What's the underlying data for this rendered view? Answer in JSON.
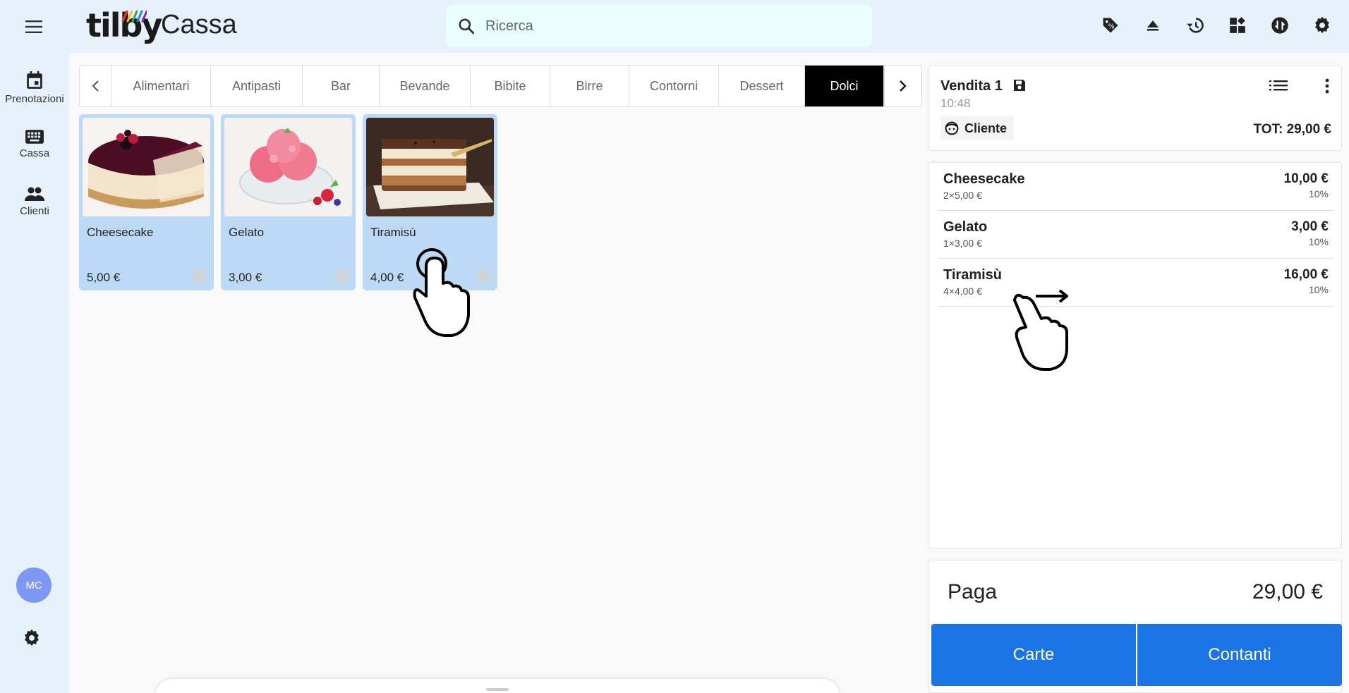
{
  "header": {
    "brand": "tilby",
    "title": "Cassa",
    "search_placeholder": "Ricerca",
    "icons": [
      "tag-icon",
      "eject-icon",
      "history-icon",
      "widgets-icon",
      "sync-icon",
      "settings-icon"
    ]
  },
  "sidebar": {
    "items": [
      {
        "label": "Prenotazioni",
        "icon": "calendar-icon"
      },
      {
        "label": "Cassa",
        "icon": "keyboard-icon"
      },
      {
        "label": "Clienti",
        "icon": "people-icon"
      }
    ],
    "avatar": "MC"
  },
  "categories": {
    "tabs": [
      "Alimentari",
      "Antipasti",
      "Bar",
      "Bevande",
      "Bibite",
      "Birre",
      "Contorni",
      "Dessert",
      "Dolci"
    ],
    "active": "Dolci"
  },
  "products": [
    {
      "name": "Cheesecake",
      "price": "5,00 €"
    },
    {
      "name": "Gelato",
      "price": "3,00 €"
    },
    {
      "name": "Tiramisù",
      "price": "4,00 €"
    }
  ],
  "sale": {
    "title": "Vendita 1",
    "time": "10:48",
    "customer_label": "Cliente",
    "total": "TOT: 29,00 €",
    "items": [
      {
        "name": "Cheesecake",
        "qty": "2×5,00 €",
        "total": "10,00 €",
        "vat": "10%"
      },
      {
        "name": "Gelato",
        "qty": "1×3,00 €",
        "total": "3,00 €",
        "vat": "10%"
      },
      {
        "name": "Tiramisù",
        "qty": "4×4,00 €",
        "total": "16,00 €",
        "vat": "10%"
      }
    ]
  },
  "payment": {
    "label": "Paga",
    "amount": "29,00 €",
    "cards_label": "Carte",
    "cash_label": "Contanti"
  },
  "colors": {
    "accent": "#1b74e4",
    "header_bg": "#e6f1fb",
    "tile_bg": "#bcd9f6",
    "active_tab": "#000000",
    "avatar_bg": "#7d97f3"
  }
}
